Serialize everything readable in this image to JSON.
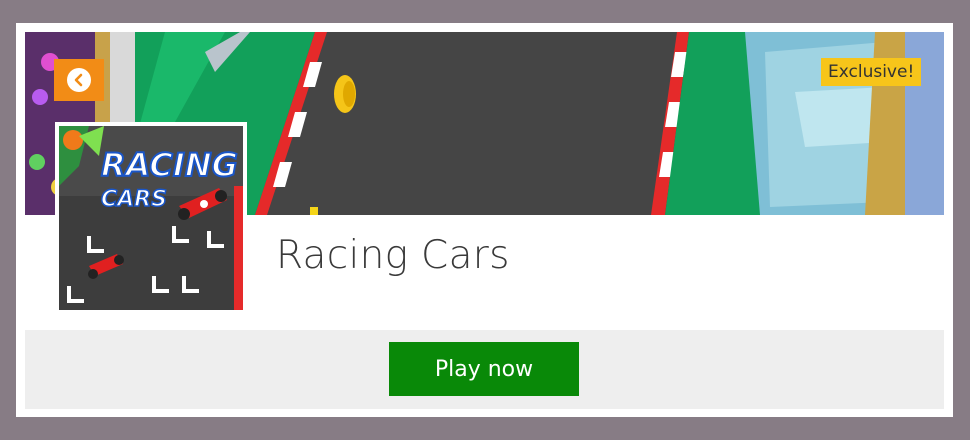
{
  "game": {
    "title": "Racing Cars",
    "badge": "Exclusive!",
    "thumbnail_logo_line1": "RACING",
    "thumbnail_logo_line2": "CARS"
  },
  "actions": {
    "back_icon": "chevron-left-icon",
    "play_label": "Play now"
  },
  "colors": {
    "page_bg": "#877c85",
    "back_button": "#f28c16",
    "badge": "#f7c51a",
    "play_button": "#098908"
  }
}
